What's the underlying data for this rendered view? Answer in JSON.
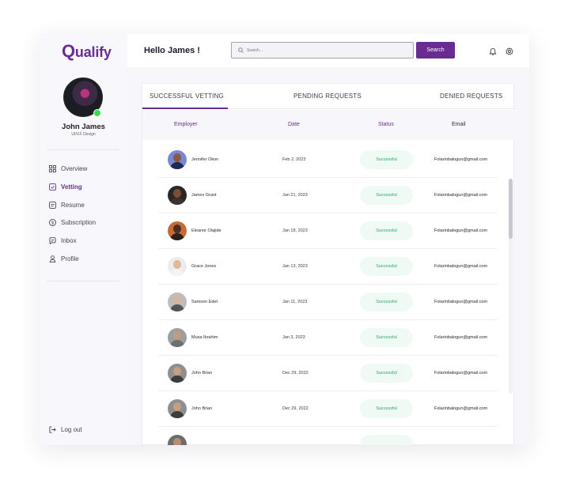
{
  "brand": {
    "logo_q": "Q",
    "logo_rest": "ualify",
    "accent": "#6a2c91"
  },
  "user": {
    "name": "John James",
    "role": "UI/UX Design",
    "online_color": "#2ee04b"
  },
  "sidebar": {
    "items": [
      {
        "label": "Overview",
        "icon": "grid-icon"
      },
      {
        "label": "Vetting",
        "icon": "checkbox-icon",
        "active": true
      },
      {
        "label": "Resume",
        "icon": "document-icon"
      },
      {
        "label": "Subscription",
        "icon": "dollar-icon"
      },
      {
        "label": "Inbox",
        "icon": "chat-icon"
      },
      {
        "label": "Profile",
        "icon": "user-icon"
      }
    ],
    "logout_label": "Log out"
  },
  "header": {
    "greeting": "Hello James !",
    "search_placeholder": "Search...",
    "search_button": "Search"
  },
  "tabs": [
    {
      "label": "SUCCESSFUL VETTING",
      "active": true
    },
    {
      "label": "PENDING REQUESTS"
    },
    {
      "label": "DENIED REQUESTS"
    }
  ],
  "table": {
    "columns": [
      "Employer",
      "Date",
      "Status",
      "Email"
    ],
    "rows": [
      {
        "name": "Jennifer Okon",
        "date": "Feb 2, 2023",
        "status": "Successful",
        "email": "Folarinbalogun@gmail.com"
      },
      {
        "name": "James Grant",
        "date": "Jan 21, 2023",
        "status": "Successful",
        "email": "Folarinbalogun@gmail.com"
      },
      {
        "name": "Eleanor Olajide",
        "date": "Jan 18, 2023",
        "status": "Successful",
        "email": "Folarinbalogun@gmail.com"
      },
      {
        "name": "Grace Jones",
        "date": "Jan 13, 2023",
        "status": "Successful",
        "email": "Folarinbalogun@gmail.com"
      },
      {
        "name": "Samson Edet",
        "date": "Jan 11, 2023",
        "status": "Successful",
        "email": "Folarinbalogun@gmail.com"
      },
      {
        "name": "Musa Ibrahim",
        "date": "Jan 3, 2023",
        "status": "Successful",
        "email": "Folarinbalogun@gmail.com"
      },
      {
        "name": "John Brian",
        "date": "Dec 29, 2022",
        "status": "Successful",
        "email": "Folarinbalogun@gmail.com"
      },
      {
        "name": "John Brian",
        "date": "Dec 29, 2022",
        "status": "Successful",
        "email": "Folarinbalogun@gmail.com"
      }
    ],
    "status_color": "#28a86a"
  }
}
